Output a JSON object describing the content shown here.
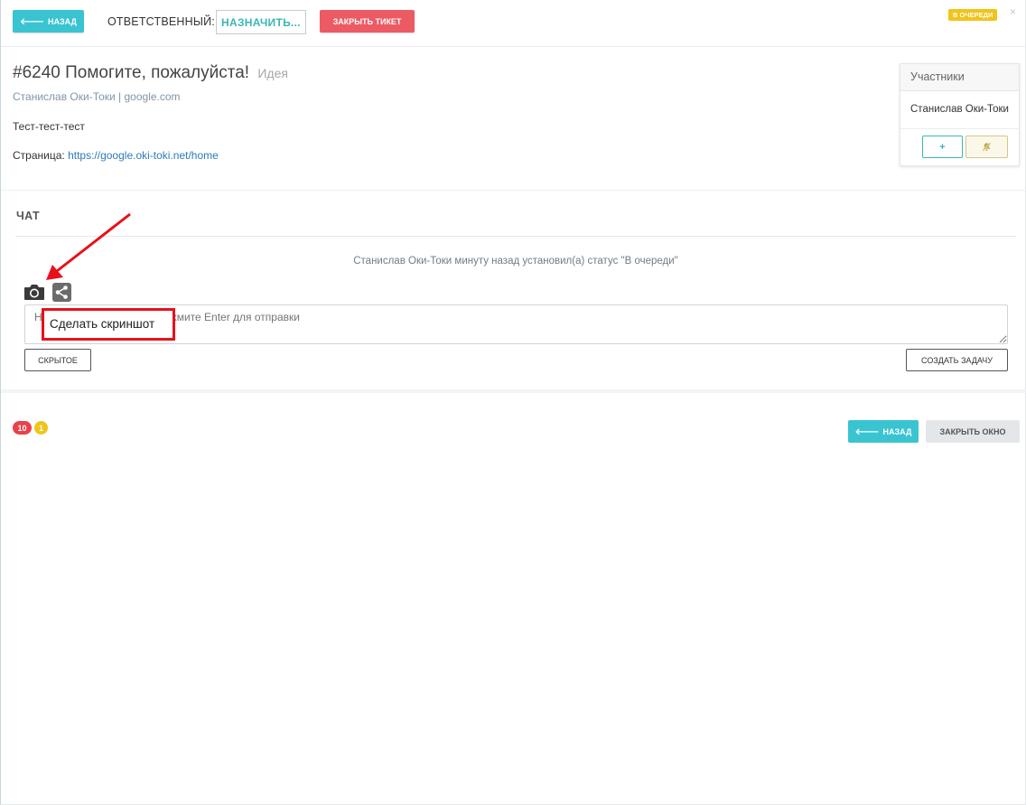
{
  "topbar": {
    "back_label": "НАЗАД",
    "responsible_label": "ОТВЕТСТВЕННЫЙ:",
    "assign_label": "НАЗНАЧИТЬ...",
    "close_ticket_label": "ЗАКРЫТЬ ТИКЕТ",
    "status_badge": "В ОЧЕРЕДИ",
    "close_icon": "×"
  },
  "ticket": {
    "title": "#6240 Помогите, пожалуйста!",
    "type": "Идея",
    "author": "Станислав Оки-Токи | google.com",
    "description": "Тест-тест-тест",
    "page_label": "Страница: ",
    "page_url": "https://google.oki-toki.net/home"
  },
  "participants": {
    "heading": "Участники",
    "names": [
      "Станислав Оки-Токи"
    ],
    "add_label": "+",
    "mute_label": "🔕"
  },
  "chat": {
    "title": "ЧАТ",
    "system_message": "Станислав Оки-Токи минуту назад установил(а) статус \"В очереди\"",
    "input_placeholder": "Напишите сообщение и нажмите Enter для отправки",
    "tooltip": "Сделать скриншот",
    "hidden_label": "СКРЫТОЕ",
    "create_task_label": "СОЗДАТЬ ЗАДАЧУ"
  },
  "footer": {
    "badge_red": "10",
    "badge_yellow": "1",
    "back_label": "НАЗАД",
    "close_window_label": "ЗАКРЫТЬ ОКНО"
  },
  "colors": {
    "accent_teal": "#3ac4d2",
    "danger_red": "#ec5a63",
    "status_yellow": "#f0c419",
    "annotation_red": "#e8111a"
  },
  "icons": [
    "arrow-left-icon",
    "camera-icon",
    "share-icon",
    "close-icon",
    "plus-icon",
    "bell-slash-icon",
    "annotation-arrow"
  ]
}
